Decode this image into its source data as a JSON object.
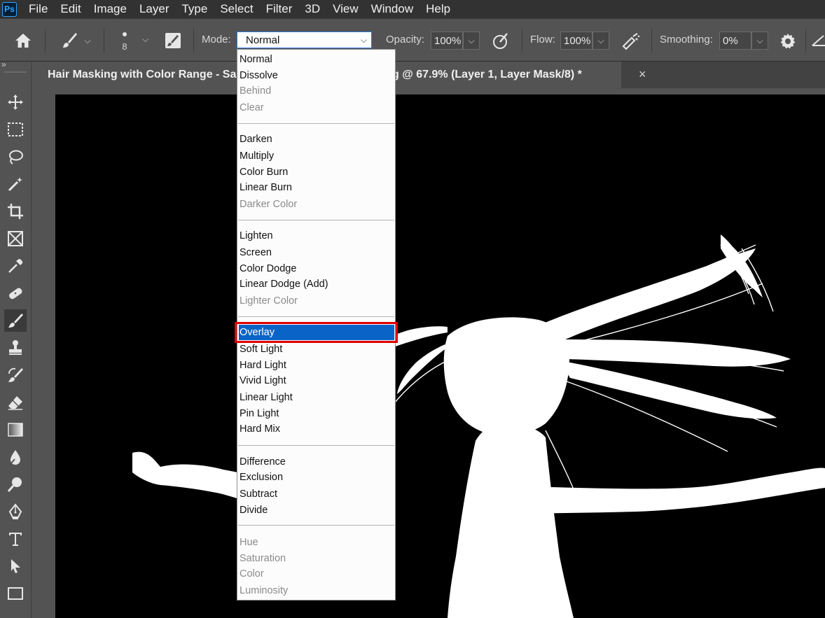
{
  "app": {
    "logo_text": "Ps"
  },
  "menu": [
    "File",
    "Edit",
    "Image",
    "Layer",
    "Type",
    "Select",
    "Filter",
    "3D",
    "View",
    "Window",
    "Help"
  ],
  "options": {
    "brush_size": "8",
    "mode_label": "Mode:",
    "mode_value": "Normal",
    "opacity_label": "Opacity:",
    "opacity_value": "100%",
    "flow_label": "Flow:",
    "flow_value": "100%",
    "smoothing_label": "Smoothing:",
    "smoothing_value": "0%"
  },
  "collapse_glyph": "»",
  "document": {
    "tab_title": "Hair Masking with Color Range - Sa",
    "tab_title_tail": "g @ 67.9% (Layer 1, Layer Mask/8) *",
    "close_glyph": "×"
  },
  "blend_modes": {
    "groups": [
      [
        {
          "label": "Normal"
        },
        {
          "label": "Dissolve"
        },
        {
          "label": "Behind",
          "disabled": true
        },
        {
          "label": "Clear",
          "disabled": true
        }
      ],
      [
        {
          "label": "Darken"
        },
        {
          "label": "Multiply"
        },
        {
          "label": "Color Burn"
        },
        {
          "label": "Linear Burn"
        },
        {
          "label": "Darker Color",
          "disabled": true
        }
      ],
      [
        {
          "label": "Lighten"
        },
        {
          "label": "Screen"
        },
        {
          "label": "Color Dodge"
        },
        {
          "label": "Linear Dodge (Add)"
        },
        {
          "label": "Lighter Color",
          "disabled": true
        }
      ],
      [
        {
          "label": "Overlay",
          "selected": true
        },
        {
          "label": "Soft Light"
        },
        {
          "label": "Hard Light"
        },
        {
          "label": "Vivid Light"
        },
        {
          "label": "Linear Light"
        },
        {
          "label": "Pin Light"
        },
        {
          "label": "Hard Mix"
        }
      ],
      [
        {
          "label": "Difference"
        },
        {
          "label": "Exclusion"
        },
        {
          "label": "Subtract"
        },
        {
          "label": "Divide"
        }
      ],
      [
        {
          "label": "Hue",
          "disabled": true
        },
        {
          "label": "Saturation",
          "disabled": true
        },
        {
          "label": "Color",
          "disabled": true
        },
        {
          "label": "Luminosity",
          "disabled": true
        }
      ]
    ]
  },
  "tools": [
    "move-icon",
    "marquee-icon",
    "lasso-icon",
    "magic-wand-icon",
    "crop-icon",
    "frame-icon",
    "eyedropper-icon",
    "healing-brush-icon",
    "brush-icon",
    "clone-stamp-icon",
    "history-brush-icon",
    "eraser-icon",
    "gradient-icon",
    "blur-icon",
    "dodge-icon",
    "pen-icon",
    "type-icon",
    "path-selection-icon",
    "rectangle-icon"
  ],
  "colors": {
    "highlight": "#0a64c8",
    "annotation": "#e00000",
    "canvas": "#000000"
  }
}
